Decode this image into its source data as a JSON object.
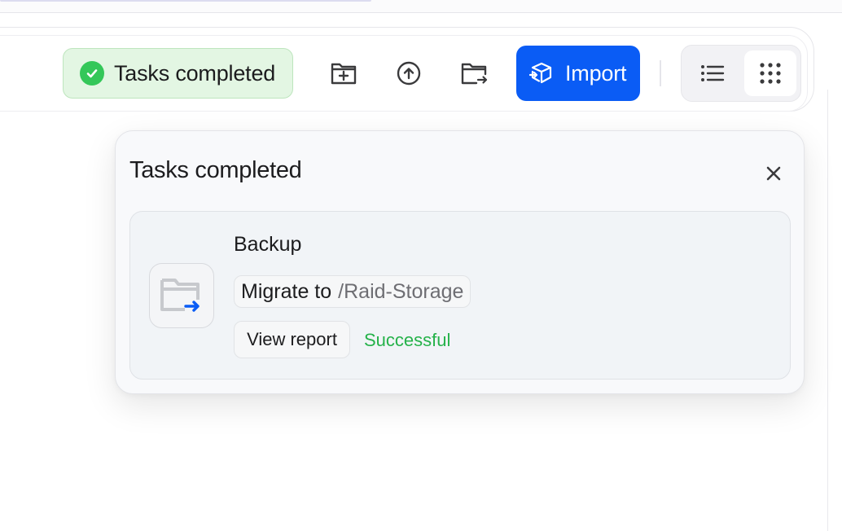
{
  "toolbar": {
    "status_label": "Tasks completed",
    "import_label": "Import",
    "icons": {
      "status": "check-circle-icon",
      "new_folder": "folder-plus-icon",
      "upload": "upload-circle-icon",
      "move": "folder-move-icon",
      "import": "box-import-icon",
      "list_view": "list-icon",
      "grid_view": "grid-dots-icon"
    },
    "active_view": "grid"
  },
  "popover": {
    "title": "Tasks completed",
    "close_icon": "close-icon",
    "tasks": [
      {
        "name": "Backup",
        "action": "Migrate to",
        "destination": "/Raid-Storage",
        "report_label": "View report",
        "result": "Successful",
        "icon": "folder-move-icon"
      }
    ]
  },
  "colors": {
    "accent": "#0a5cf5",
    "success": "#34c759",
    "success_text": "#25b24a",
    "status_bg": "#e3f6e3"
  }
}
